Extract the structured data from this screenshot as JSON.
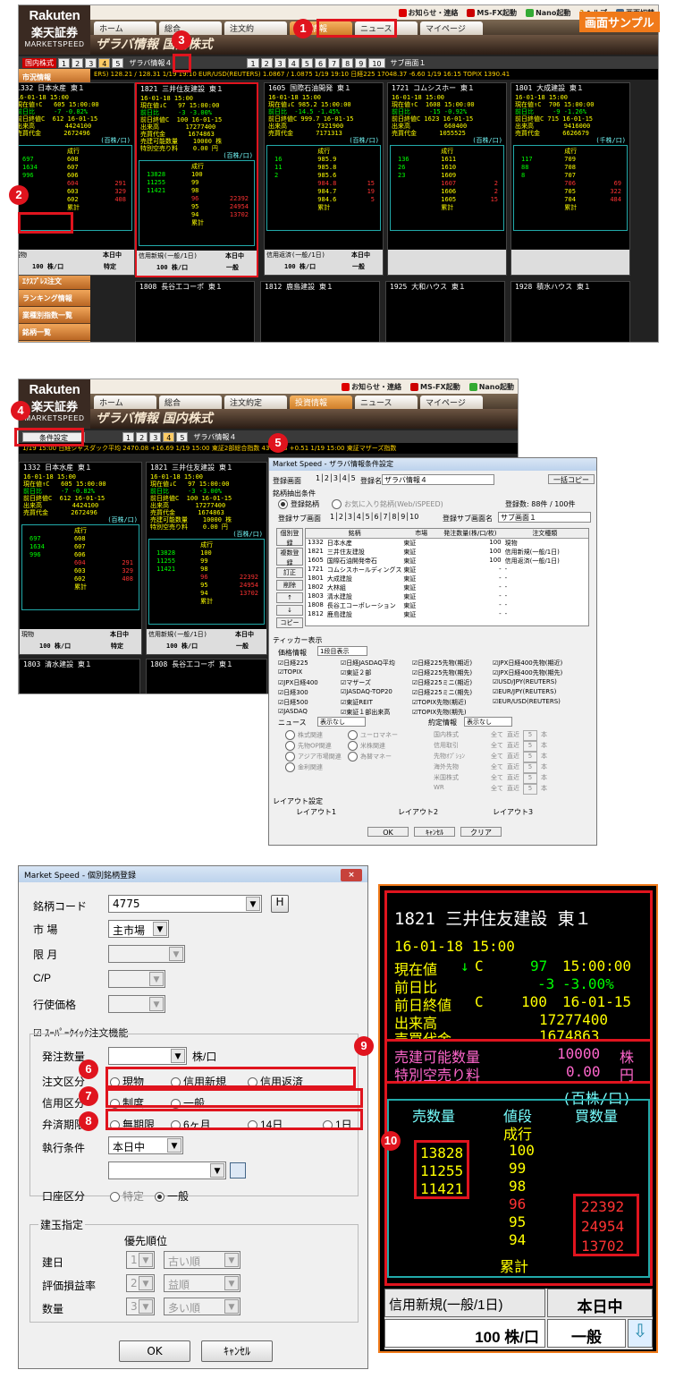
{
  "sample_label": "画面サンプル",
  "logo": {
    "rakuten": "Rakuten",
    "shoken": "楽天証券",
    "ms": "MARKETSPEED"
  },
  "topbar": [
    "お知らせ・連絡",
    "MS-FX起動",
    "Nano起動",
    "ヘルプ",
    "画面切替"
  ],
  "menu": [
    "ホーム",
    "総合",
    "注文約",
    "投資情報",
    "ニュース",
    "マイページ"
  ],
  "title": "ザラバ情報 国内株式",
  "menu2": [
    "ホーム",
    "総合",
    "注文約定",
    "投資情報",
    "ニュース",
    "マイページ"
  ],
  "ctrl": {
    "market": "国内株式",
    "pages": [
      "1",
      "2",
      "3",
      "4",
      "5"
    ],
    "label": "ザラバ情報４",
    "sub": "サブ画面１",
    "subpages": [
      "1",
      "2",
      "3",
      "4",
      "5",
      "6",
      "7",
      "8",
      "9",
      "10"
    ]
  },
  "ticker1": "ERS) 128.21 / 128.31 1/19 19:10 EUR/USD(REUTERS) 1.0867 / 1.0875 1/19 19:10 日経225 17048.37 -6.60 1/19 16:15 TOPIX 1390.41",
  "ticker2": "1/19 15:00 日経ジャスダック平均 2470.08 +16.69 1/19 15:00 東証2部総合指数 4370.58 +0.51 1/19 15:00 東証マザーズ指数",
  "side": [
    "市況情報",
    "市況情報フル板",
    "先物OP市況情報",
    "個別チャート",
    "先物OPチャート",
    "複合チャート",
    "損益線チャート",
    "ニース列情報",
    "注目銘柄情報",
    "ザラバ情報",
    "ザラバフル板",
    "武蔵",
    "ｴｸｽﾌﾟﾚｽ注文",
    "ランキング情報",
    "業種別指数一覧",
    "銘柄一覧",
    "銘柄動向速報"
  ],
  "badges": [
    "1",
    "2",
    "3",
    "4",
    "5",
    "6",
    "7",
    "8",
    "9",
    "10"
  ],
  "panels": [
    {
      "head": "1821 三井住友建設 東１",
      "date": "16-01-18 15:00",
      "l1": "現在値↓C   97 15:00:00",
      "l2": "前日比     -3 -3.00%",
      "l3": "前日終値C  100 16-01-15",
      "l4": "出来高       17277400",
      "l5": "売買代金      1674863",
      "l6": "売建可能数量    10000 株",
      "l7": "特別空売り料    0.00 円",
      "unit": "(百株/口)",
      "asks": [
        "13828",
        "11255",
        "11421"
      ],
      "prices": [
        "成行",
        "100",
        "99",
        "98",
        "96",
        "95",
        "94",
        "累計"
      ],
      "bids": [
        "22392",
        "24954",
        "13702"
      ],
      "f1": "信用新規(一般/1日)",
      "f2": "本日中",
      "f3": "100 株/口",
      "f4": "一般"
    },
    {
      "head": "1605 国際石油開発 東１",
      "date": "16-01-18 15:00",
      "l1": "現在値↓C 985.2 15:00:00",
      "l2": "前日比  -14.5 -1.45%",
      "l3": "前日終値C 999.7 16-01-15",
      "l4": "出来高        7321900",
      "l5": "売買代金      7171313",
      "l6": "",
      "l7": "",
      "unit": "(百株/口)",
      "asks": [
        "16",
        "11",
        "2"
      ],
      "prices": [
        "成行",
        "985.9",
        "985.8",
        "985.6",
        "984.8",
        "984.7",
        "984.6",
        "累計"
      ],
      "bids": [
        "15",
        "19",
        "5"
      ],
      "f1": "信用返済(一般/1日)",
      "f2": "本日中",
      "f3": "100 株/口",
      "f4": "一般"
    },
    {
      "head": "1721 コムシスホー 東１",
      "date": "16-01-18 15:00",
      "l1": "現在値↑C  1608 15:00:00",
      "l2": "前日比     -15 -0.92%",
      "l3": "前日終値C 1623 16-01-15",
      "l4": "出来高         660400",
      "l5": "売買代金      1055525",
      "l6": "",
      "l7": "",
      "unit": "(百株/口)",
      "asks": [
        "136",
        "26",
        "23"
      ],
      "prices": [
        "成行",
        "1611",
        "1610",
        "1609",
        "1607",
        "1606",
        "1605",
        "累計"
      ],
      "bids": [
        "2",
        "2",
        "15"
      ],
      "f1": "",
      "f2": "",
      "f3": "",
      "f4": ""
    },
    {
      "head": "1801 大成建設 東１",
      "date": "16-01-18 15:00",
      "l1": "現在値↑C  706 15:00:00",
      "l2": "前日比     -9 -1.26%",
      "l3": "前日終値C 715 16-01-15",
      "l4": "出来高        9416000",
      "l5": "売買代金      6626679",
      "l6": "",
      "l7": "",
      "unit": "(千株/口)",
      "asks": [
        "117",
        "88",
        "8"
      ],
      "prices": [
        "成行",
        "709",
        "708",
        "707",
        "706",
        "705",
        "704",
        "累計"
      ],
      "bids": [
        "69",
        "322",
        "484"
      ],
      "f1": "",
      "f2": "",
      "f3": "",
      "f4": ""
    },
    {
      "head": "1332 日本水産 東１",
      "date": "16-01-18 15:00",
      "l1": "現在値↑C   605 15:00:00",
      "l2": "前日比     -7 -0.82%",
      "l3": "前日終値C  612 16-01-15",
      "l4": "出来高        4424100",
      "l5": "売買代金      2672496",
      "l6": "",
      "l7": "",
      "unit": "(百株/口)",
      "asks": [
        "697",
        "1634",
        "996"
      ],
      "prices": [
        "成行",
        "608",
        "607",
        "606",
        "604",
        "603",
        "602",
        "累計"
      ],
      "bids": [
        "291",
        "329",
        "408"
      ],
      "f1": "現物",
      "f2": "本日中",
      "f3": "100 株/口",
      "f4": "特定"
    }
  ],
  "row2": [
    "1808 長谷工コーポ 東１",
    "1812 鹿島建設 東１",
    "1925 大和ハウス 東１",
    "1928 積水ハウス 東１",
    "1803 清水建設 東１",
    "1808 長谷工コーポ 東１"
  ],
  "setting": {
    "btn": "条件設定",
    "title": "Market Speed - ザラバ情報条件設定",
    "reg": "登録画面",
    "name_label": "登録名",
    "name": "ザラバ情報４",
    "copy": "一括コピー",
    "src": "銘柄抽出条件",
    "opt1": "登録銘柄",
    "opt2": "お気に入り銘柄(Web/iSPEED)",
    "count": "登録数:  88件 / 100件",
    "sub_label": "登録サブ画面",
    "subname_label": "登録サブ画面名",
    "subname": "サブ画面１",
    "cols": [
      "銘柄",
      "市場",
      "発注数量(株/口/枚)",
      "注文種類"
    ],
    "rows": [
      [
        "1332",
        "日本水産",
        "東証",
        "100",
        "現物"
      ],
      [
        "1821",
        "三井住友建設",
        "東証",
        "100",
        "信用新規(一般/1日)"
      ],
      [
        "1605",
        "国際石油開発帝石",
        "東証",
        "100",
        "信用返済(一般/1日)"
      ],
      [
        "1721",
        "コムシスホールディングス",
        "東証",
        "-",
        "-"
      ],
      [
        "1801",
        "大成建設",
        "東証",
        "-",
        "-"
      ],
      [
        "1802",
        "大林組",
        "東証",
        "-",
        "-"
      ],
      [
        "1803",
        "清水建設",
        "東証",
        "-",
        "-"
      ],
      [
        "1808",
        "長谷工コーポレーション",
        "東証",
        "-",
        "-"
      ],
      [
        "1812",
        "鹿島建設",
        "東証",
        "-",
        "-"
      ]
    ],
    "sidebtns": [
      "個別登録",
      "複数登録",
      "訂正",
      "削除",
      "↑",
      "↓",
      "コピー"
    ],
    "ticker_title": "ティッカー表示",
    "price_label": "価格情報",
    "price_sel": "1段目表示",
    "ticks": [
      "日経225",
      "日経JASDAQ平均",
      "日経225先物(期近)",
      "JPX日経400先物(期近)",
      "TOPIX",
      "東証２部",
      "日経225先物(期先)",
      "JPX日経400先物(期先)",
      "JPX日経400",
      "マザーズ",
      "日経225ミニ(期近)",
      "USD/JPY(REUTERS)",
      "日経300",
      "JASDAQ-TOP20",
      "日経225ミニ(期先)",
      "EUR/JPY(REUTERS)",
      "日経500",
      "東証REIT",
      "TOPIX先物(期近)",
      "EUR/USD(REUTERS)",
      "JASDAQ",
      "東証１部出来高",
      "TOPIX先物(期先)",
      ""
    ],
    "news": "ニュース",
    "news_sel": "表示なし",
    "yaku": "約定情報",
    "yaku_sel": "表示なし",
    "newsopts": [
      "株式関連",
      "ユーロマネー",
      "先物OP関連",
      "米株関連",
      "アジア市場関連",
      "為替マネー",
      "金利関連"
    ],
    "yakuopts": [
      "国内株式",
      "信用取引",
      "先物ｵﾌﾟｼｮﾝ",
      "海外先物",
      "米国株式",
      "WR"
    ],
    "all": "全て",
    "recent": "直近",
    "num": "5",
    "hon": "本",
    "layout_title": "レイアウト設定",
    "layouts": [
      "レイアウト1",
      "レイアウト2",
      "レイアウト3"
    ],
    "ok": "OK",
    "cancel": "ｷｬﾝｾﾙ",
    "clear": "クリア"
  },
  "reg": {
    "title": "Market Speed - 個別銘柄登録",
    "code_label": "銘柄コード",
    "code": "4775",
    "h": "H",
    "market_label": "市 場",
    "market": "主市場",
    "month_label": "限 月",
    "cp_label": "C/P",
    "strike_label": "行使価格",
    "sq_label": "ｽｰﾊﾟｰｸｲｯｸ注文機能",
    "qty_label": "発注数量",
    "unit": "株/口",
    "type_label": "注文区分",
    "types": [
      "現物",
      "信用新規",
      "信用返済"
    ],
    "credit_label": "信用区分",
    "credits": [
      "制度",
      "一般"
    ],
    "due_label": "弁済期限",
    "dues": [
      "無期限",
      "6ヶ月",
      "14日",
      "1日"
    ],
    "cond_label": "執行条件",
    "cond": "本日中",
    "acct_label": "口座区分",
    "accts": [
      "特定",
      "一般"
    ],
    "kenn": "建玉指定",
    "prio": "優先順位",
    "k1": "建日",
    "k1v": "古い順",
    "k2": "評価損益率",
    "k2v": "益順",
    "k3": "数量",
    "k3v": "多い順",
    "ok": "OK",
    "cancel": "ｷｬﾝｾﾙ"
  },
  "zoom": {
    "head": "1821 三井住友建設 東１",
    "date": "16-01-18 15:00",
    "l1a": "現在値",
    "l1b": "C",
    "l1c": "97",
    "l1d": "15:00:00",
    "l2a": "前日比",
    "l2c": "-3",
    "l2d": "-3.00%",
    "l3a": "前日終値",
    "l3b": "C",
    "l3c": "100",
    "l3d": "16-01-15",
    "l4a": "出来高",
    "l4c": "17277400",
    "l5a": "売買代金",
    "l5c": "1674863",
    "sell_label": "売建可能数量",
    "sell_val": "10000",
    "sell_unit": "株",
    "fee_label": "特別空売り料",
    "fee_val": "0.00",
    "fee_unit": "円",
    "unit": "(百株/口)",
    "h1": "売数量",
    "h2": "値段",
    "h3": "買数量",
    "nari": "成行",
    "asks": [
      "13828",
      "11255",
      "11421"
    ],
    "prices": [
      "100",
      "99",
      "98",
      "96",
      "95",
      "94"
    ],
    "bids": [
      "22392",
      "24954",
      "13702"
    ],
    "total": "累計",
    "f1": "信用新規(一般/1日)",
    "f2": "本日中",
    "f3": "100 株/口",
    "f4": "一般"
  }
}
